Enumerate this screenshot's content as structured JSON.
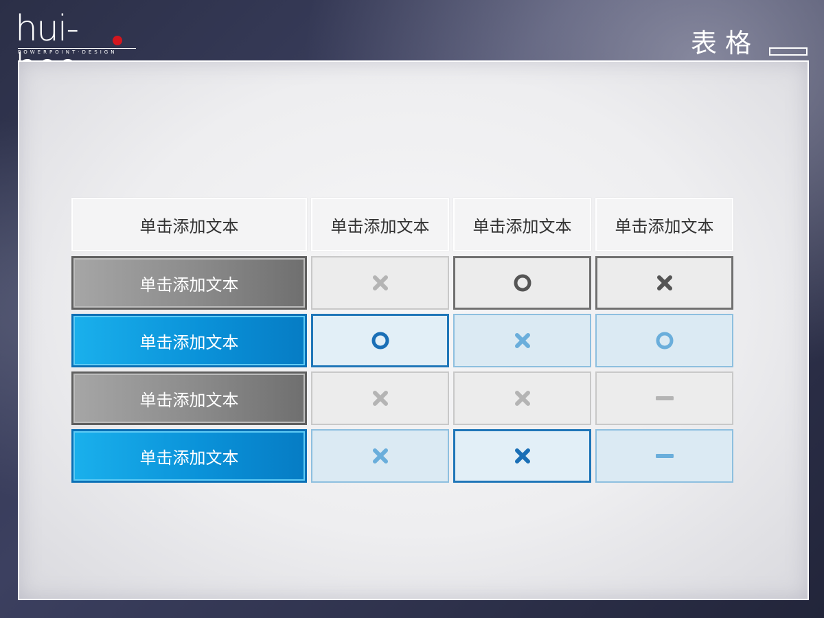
{
  "brand": {
    "logo_text": "hui-hoo",
    "logo_subtitle": "POWERPOINT·DESIGN"
  },
  "slide": {
    "title": "表格"
  },
  "colors": {
    "accent_blue": "#0a92d9",
    "dark_blue": "#1a6fb6",
    "mid_blue": "#6aaedb",
    "dark_gray": "#555555",
    "light_gray": "#b4b4b4",
    "logo_red": "#d3161e"
  },
  "table": {
    "headers": [
      "单击添加文本",
      "单击添加文本",
      "单击添加文本",
      "单击添加文本"
    ],
    "rows": [
      {
        "label": "单击添加文本",
        "style": "gray",
        "cells": [
          {
            "icon": "cross-icon",
            "tone": "light-gray"
          },
          {
            "icon": "circle-icon",
            "tone": "dark-gray"
          },
          {
            "icon": "cross-icon",
            "tone": "dark-gray"
          }
        ]
      },
      {
        "label": "单击添加文本",
        "style": "blue",
        "cells": [
          {
            "icon": "circle-icon",
            "tone": "dark-blue"
          },
          {
            "icon": "cross-icon",
            "tone": "light-blue"
          },
          {
            "icon": "circle-icon",
            "tone": "light-blue"
          }
        ]
      },
      {
        "label": "单击添加文本",
        "style": "gray",
        "cells": [
          {
            "icon": "cross-icon",
            "tone": "light-gray"
          },
          {
            "icon": "cross-icon",
            "tone": "light-gray"
          },
          {
            "icon": "dash-icon",
            "tone": "light-gray"
          }
        ]
      },
      {
        "label": "单击添加文本",
        "style": "blue",
        "cells": [
          {
            "icon": "cross-icon",
            "tone": "light-blue"
          },
          {
            "icon": "cross-icon",
            "tone": "dark-blue"
          },
          {
            "icon": "dash-icon",
            "tone": "light-blue"
          }
        ]
      }
    ]
  }
}
